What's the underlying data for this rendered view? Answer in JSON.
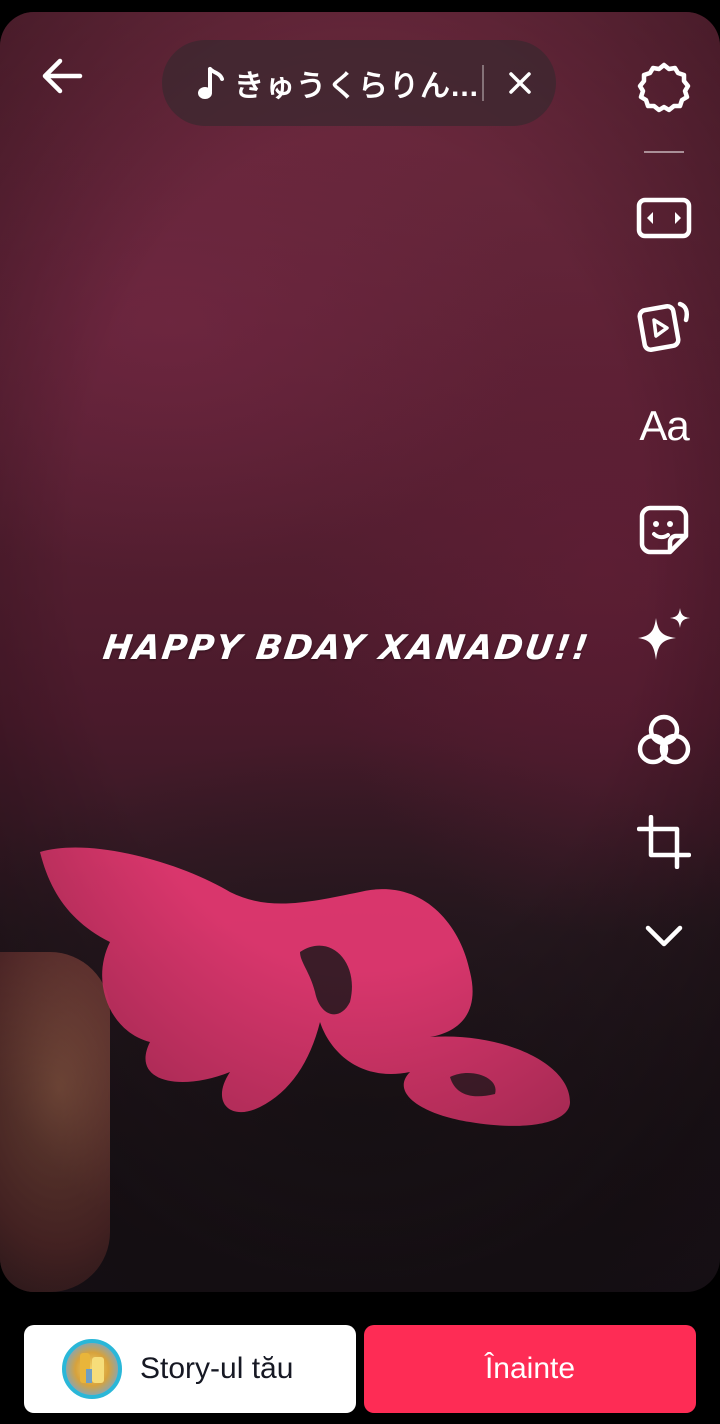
{
  "music": {
    "title": "きゅうくらりん...",
    "note_icon": "music-note-icon",
    "close_icon": "close-icon"
  },
  "toolbar": {
    "items": [
      {
        "name": "settings",
        "icon": "gear-icon"
      },
      {
        "name": "resize",
        "icon": "aspect-ratio-icon"
      },
      {
        "name": "clips",
        "icon": "video-clips-icon"
      },
      {
        "name": "text",
        "label": "Aa",
        "icon": "text-icon"
      },
      {
        "name": "stickers",
        "icon": "sticker-icon"
      },
      {
        "name": "effects",
        "icon": "sparkle-icon"
      },
      {
        "name": "filters",
        "icon": "filters-icon"
      },
      {
        "name": "crop",
        "icon": "crop-icon"
      },
      {
        "name": "more",
        "icon": "chevron-down-icon"
      }
    ]
  },
  "overlay": {
    "text": "HAPPY BDAY XANADU!!"
  },
  "bottom": {
    "story_label": "Story-ul tău",
    "next_label": "Înainte"
  },
  "colors": {
    "primary": "#fe2c55",
    "story_ring": "#2ab7d8",
    "pill_bg": "#3c2830"
  }
}
